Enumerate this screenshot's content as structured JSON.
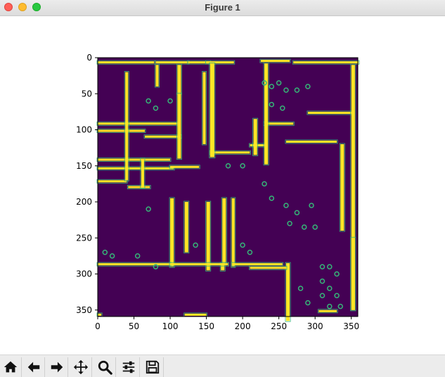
{
  "window": {
    "title": "Figure 1"
  },
  "toolbar": {
    "icons": [
      "home-icon",
      "back-arrow-icon",
      "forward-arrow-icon",
      "pan-move-icon",
      "zoom-magnifier-icon",
      "configure-subplots-icon",
      "save-floppy-icon"
    ]
  },
  "chart_data": {
    "type": "heatmap",
    "title": "",
    "xlabel": "",
    "ylabel": "",
    "colormap": "viridis",
    "xlim": [
      0,
      359
    ],
    "ylim": [
      359,
      0
    ],
    "xticks": [
      0,
      50,
      100,
      150,
      200,
      250,
      300,
      350
    ],
    "yticks": [
      0,
      50,
      100,
      150,
      200,
      250,
      300,
      350
    ],
    "xtick_labels": [
      "0",
      "50",
      "100",
      "150",
      "200",
      "250",
      "300",
      "350"
    ],
    "ytick_labels": [
      "0",
      "50",
      "100",
      "150",
      "200",
      "250",
      "300",
      "350"
    ],
    "background_color": "#440154",
    "wall_color": "#fde725",
    "edge_color": "#35b779"
  }
}
